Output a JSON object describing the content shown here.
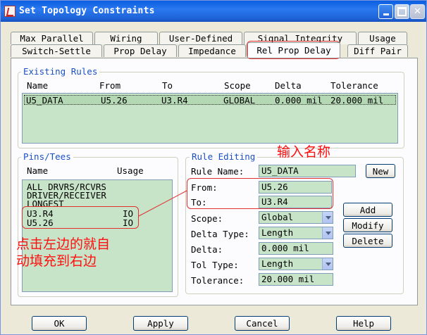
{
  "window": {
    "title": "Set Topology Constraints"
  },
  "tabs_row1": [
    "Max Parallel",
    "Wiring",
    "User-Defined",
    "Signal Integrity",
    "Usage"
  ],
  "tabs_row2": [
    "Switch-Settle",
    "Prop Delay",
    "Impedance",
    "Rel Prop Delay",
    "Diff Pair"
  ],
  "existing_rules": {
    "title": "Existing Rules",
    "columns": [
      "Name",
      "From",
      "To",
      "Scope",
      "Delta",
      "Tolerance"
    ],
    "rows": [
      {
        "name": "U5_DATA",
        "from": "U5.26",
        "to": "U3.R4",
        "scope": "GLOBAL",
        "delta": "0.000 mil",
        "tolerance": "20.000 mil"
      }
    ]
  },
  "pins_tees": {
    "title": "Pins/Tees",
    "columns": [
      "Name",
      "Usage"
    ],
    "items": [
      {
        "name": "ALL DRVRS/RCVRS",
        "usage": ""
      },
      {
        "name": "DRIVER/RECEIVER",
        "usage": ""
      },
      {
        "name": "LONGEST",
        "usage": ""
      },
      {
        "name": "U3.R4",
        "usage": "IO"
      },
      {
        "name": "U5.26",
        "usage": "IO"
      }
    ]
  },
  "rule_editing": {
    "title": "Rule Editing",
    "rule_name_label": "Rule Name:",
    "rule_name_value": "U5_DATA",
    "from_label": "From:",
    "from_value": "U5.26",
    "to_label": "To:",
    "to_value": "U3.R4",
    "scope_label": "Scope:",
    "scope_value": "Global",
    "delta_type_label": "Delta Type:",
    "delta_type_value": "Length",
    "delta_label": "Delta:",
    "delta_value": "0.000 mil",
    "tol_type_label": "Tol Type:",
    "tol_type_value": "Length",
    "tolerance_label": "Tolerance:",
    "tolerance_value": "20.000 mil"
  },
  "buttons": {
    "new": "New",
    "add": "Add",
    "modify": "Modify",
    "delete": "Delete",
    "ok": "OK",
    "apply": "Apply",
    "cancel": "Cancel",
    "help": "Help"
  },
  "annotations": {
    "enter_name": "输入名称",
    "click_left_line1": "点击左边的就自",
    "click_left_line2": "动填充到右边"
  },
  "colors": {
    "field_bg": "#c8e4c8",
    "group_title": "#1a4fc4",
    "annotation": "#ff1010",
    "titlebar": "#0a5ee0"
  }
}
